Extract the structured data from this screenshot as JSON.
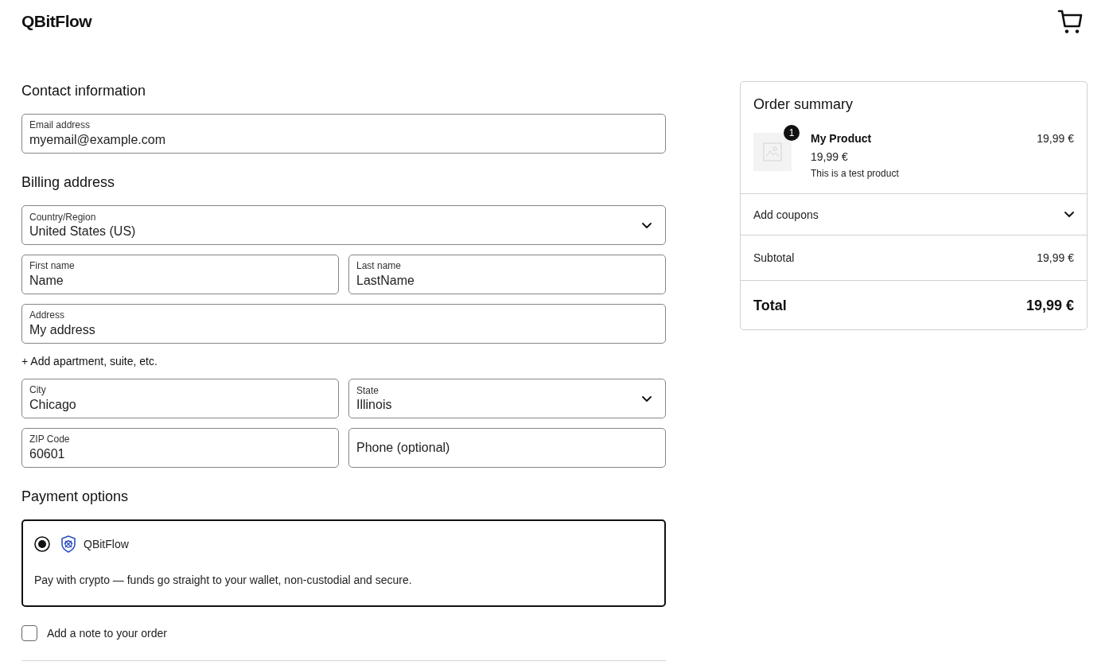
{
  "header": {
    "logo": "QBitFlow"
  },
  "contact": {
    "heading": "Contact information",
    "fields": [
      {
        "kind": "text",
        "label": "Email address",
        "value": "myemail@example.com"
      }
    ]
  },
  "billing": {
    "heading": "Billing address",
    "rows": [
      {
        "kind": "fields",
        "fields": [
          {
            "kind": "select",
            "label": "Country/Region",
            "value": "United States (US)"
          }
        ]
      },
      {
        "kind": "fields",
        "fields": [
          {
            "kind": "text",
            "label": "First name",
            "value": "Name"
          },
          {
            "kind": "text",
            "label": "Last name",
            "value": "LastName"
          }
        ]
      },
      {
        "kind": "fields",
        "fields": [
          {
            "kind": "text",
            "label": "Address",
            "value": "My address"
          }
        ]
      },
      {
        "kind": "link",
        "text": "+ Add apartment, suite, etc."
      },
      {
        "kind": "fields",
        "fields": [
          {
            "kind": "text",
            "label": "City",
            "value": "Chicago"
          },
          {
            "kind": "select",
            "label": "State",
            "value": "Illinois"
          }
        ]
      },
      {
        "kind": "fields",
        "fields": [
          {
            "kind": "text",
            "label": "ZIP Code",
            "value": "60601"
          },
          {
            "kind": "text",
            "placeholder": "Phone (optional)"
          }
        ]
      }
    ]
  },
  "payment": {
    "heading": "Payment options",
    "methods": [
      {
        "name": "QBitFlow",
        "selected": true,
        "description": "Pay with crypto — funds go straight to your wallet, non-custodial and secure."
      }
    ]
  },
  "order_note": {
    "label": "Add a note to your order",
    "checked": false
  },
  "summary": {
    "title": "Order summary",
    "items": [
      {
        "quantity": "1",
        "name": "My Product",
        "price": "19,99 €",
        "unit_price": "19,99 €",
        "description": "This is a test product"
      }
    ],
    "coupons": {
      "label": "Add coupons",
      "expanded": false
    },
    "subtotal": {
      "label": "Subtotal",
      "value": "19,99 €"
    },
    "total": {
      "label": "Total",
      "value": "19,99 €"
    }
  }
}
